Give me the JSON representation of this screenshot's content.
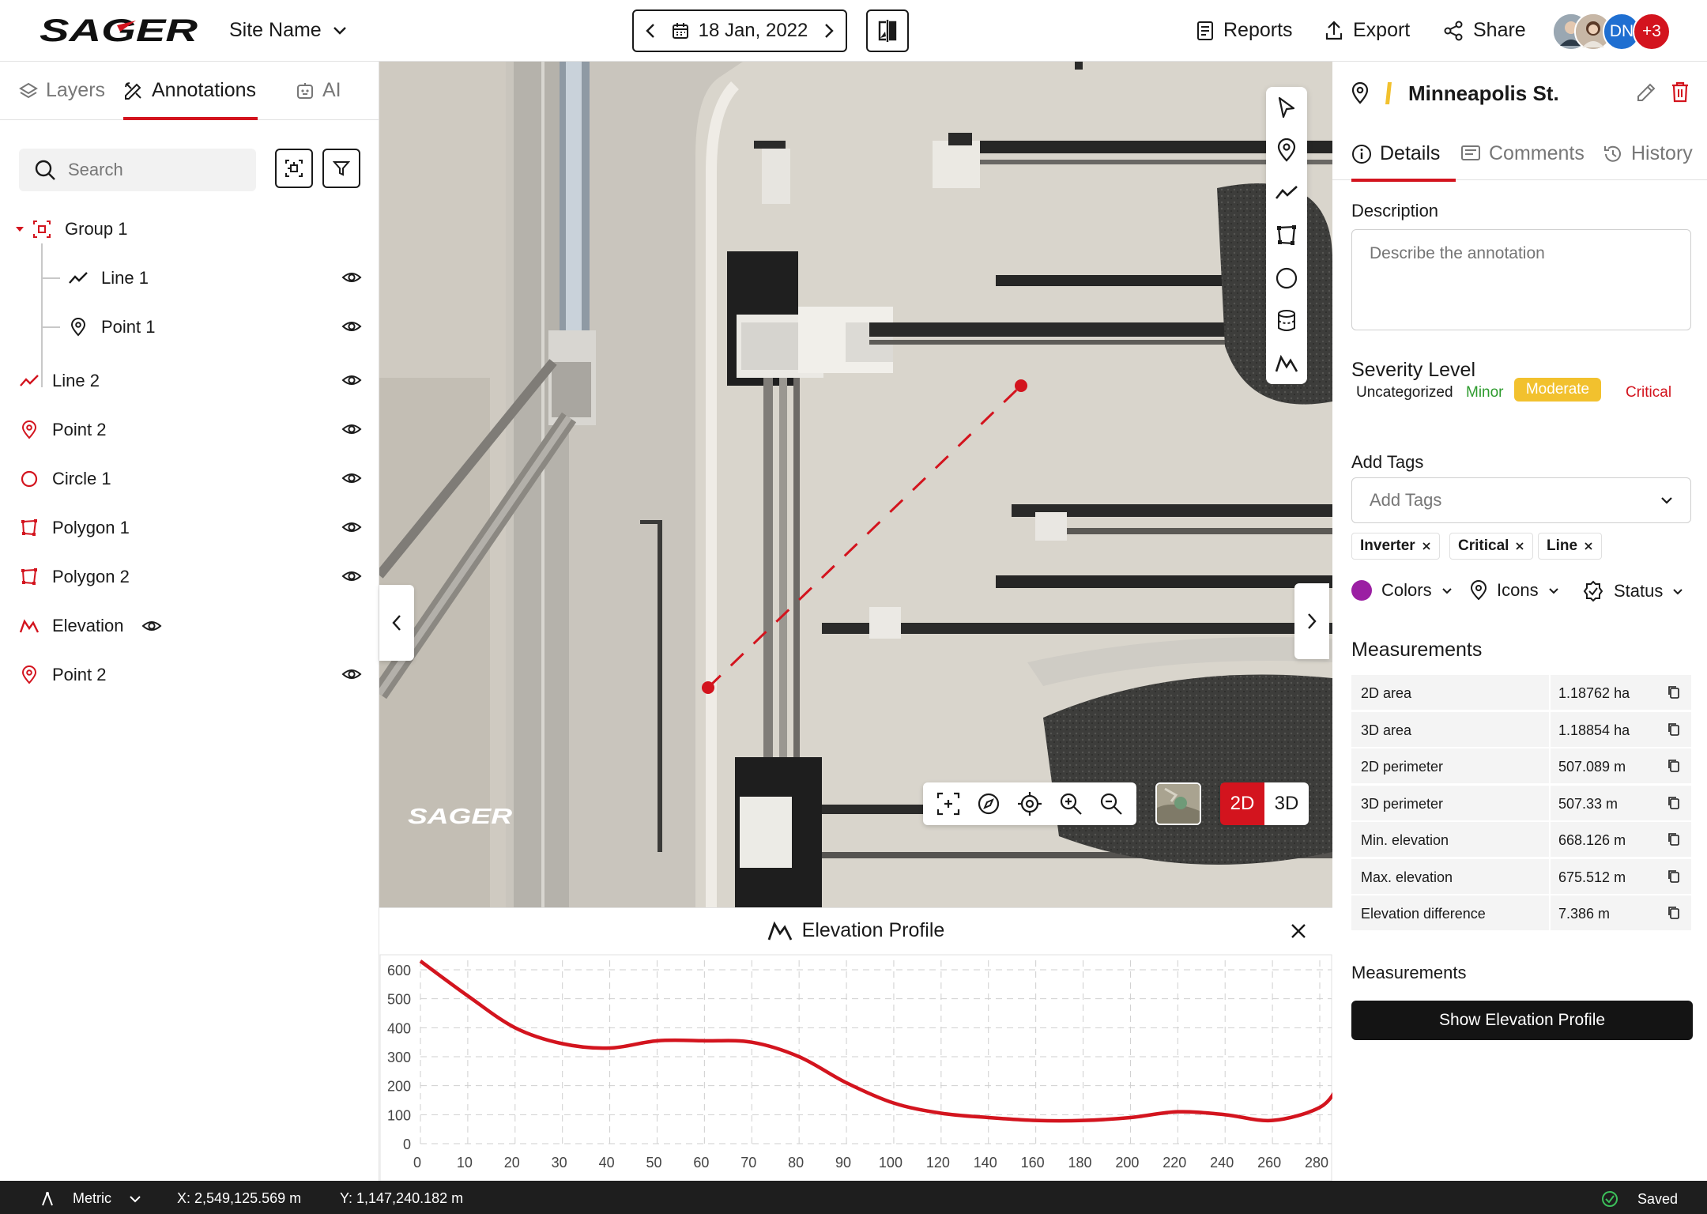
{
  "header": {
    "brand": "SAGER",
    "site_name": "Site Name",
    "date": "18 Jan, 2022",
    "actions": {
      "reports": "Reports",
      "export": "Export",
      "share": "Share"
    },
    "avatar_initials": "DN",
    "avatar_more": "+3"
  },
  "left_panel": {
    "tabs": {
      "layers": "Layers",
      "annotations": "Annotations",
      "ai": "AI"
    },
    "search_placeholder": "Search",
    "tree": {
      "group": "Group 1",
      "children": [
        "Line 1",
        "Point 1"
      ],
      "items": [
        "Line 2",
        "Point 2",
        "Circle 1",
        "Polygon 1",
        "Polygon 2",
        "Elevation",
        "Point 2"
      ]
    }
  },
  "map": {
    "view_modes": {
      "2d": "2D",
      "3d": "3D"
    },
    "active_view": "2D"
  },
  "elevation_profile": {
    "title": "Elevation Profile"
  },
  "chart_data": {
    "type": "line",
    "title": "",
    "xlabel": "",
    "ylabel": "",
    "x_ticks": [
      0,
      10,
      20,
      30,
      40,
      50,
      60,
      70,
      80,
      90,
      100,
      120,
      140,
      160,
      180,
      200,
      220,
      240,
      260,
      280
    ],
    "y_ticks": [
      0,
      100,
      200,
      300,
      400,
      500,
      600
    ],
    "ylim": [
      0,
      600
    ],
    "grid": true,
    "line_color": "#d3141e",
    "series": [
      {
        "x_index": [
          0,
          1,
          2,
          3,
          4,
          5,
          6,
          7,
          8,
          9,
          10,
          11,
          12,
          13,
          14,
          15,
          16,
          17,
          18,
          19,
          19.4
        ],
        "values": [
          630,
          510,
          400,
          345,
          330,
          355,
          355,
          350,
          300,
          210,
          140,
          105,
          90,
          80,
          80,
          90,
          110,
          100,
          80,
          125,
          200
        ]
      }
    ]
  },
  "right_panel": {
    "title": "Minneapolis St.",
    "tabs": {
      "details": "Details",
      "comments": "Comments",
      "history": "History"
    },
    "description_label": "Description",
    "description_placeholder": "Describe the annotation",
    "severity_label": "Severity Level",
    "severity": [
      "Uncategorized",
      "Minor",
      "Moderate",
      "Critical"
    ],
    "severity_selected": "Moderate",
    "tags_label": "Add Tags",
    "tags_placeholder": "Add Tags",
    "tags": [
      "Inverter",
      "Critical",
      "Line"
    ],
    "props": {
      "colors": "Colors",
      "icons": "Icons",
      "status": "Status"
    },
    "colors_value": "#9b1fa3",
    "measurements_label": "Measurements",
    "measurements": [
      {
        "label": "2D area",
        "value": "1.18762 ha"
      },
      {
        "label": "3D area",
        "value": "1.18854 ha"
      },
      {
        "label": "2D perimeter",
        "value": "507.089 m"
      },
      {
        "label": "3D perimeter",
        "value": "507.33 m"
      },
      {
        "label": "Min. elevation",
        "value": "668.126 m"
      },
      {
        "label": "Max. elevation",
        "value": "675.512 m"
      },
      {
        "label": "Elevation difference",
        "value": "7.386 m"
      }
    ],
    "measurements_label_2": "Measurements",
    "show_profile_button": "Show Elevation Profile"
  },
  "status_bar": {
    "units": "Metric",
    "x_coord": "X: 2,549,125.569 m",
    "y_coord": "Y: 1,147,240.182 m",
    "save_state": "Saved"
  },
  "colors": {
    "accent": "#d3141e",
    "moderate": "#f2c12e",
    "minor": "#2e9b2e",
    "dark": "#141414"
  }
}
